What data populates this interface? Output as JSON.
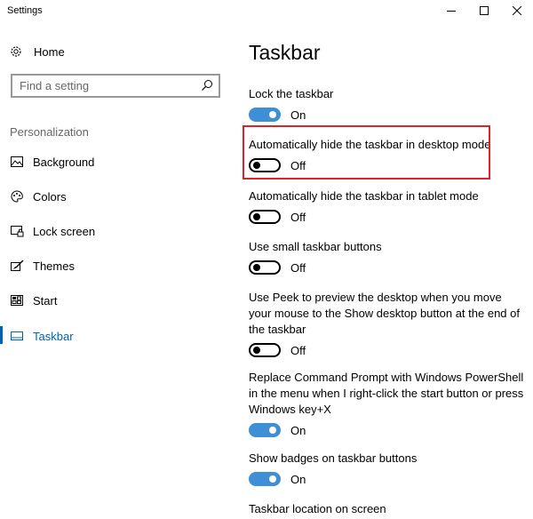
{
  "window": {
    "title": "Settings",
    "controls": {
      "minimize": "minimize-icon",
      "maximize": "maximize-icon",
      "close": "close-icon"
    }
  },
  "sidebar": {
    "home_label": "Home",
    "search_placeholder": "Find a setting",
    "section_title": "Personalization",
    "items": [
      {
        "label": "Background",
        "icon": "picture-icon"
      },
      {
        "label": "Colors",
        "icon": "palette-icon"
      },
      {
        "label": "Lock screen",
        "icon": "lock-screen-icon"
      },
      {
        "label": "Themes",
        "icon": "brush-icon"
      },
      {
        "label": "Start",
        "icon": "start-menu-icon"
      },
      {
        "label": "Taskbar",
        "icon": "taskbar-icon",
        "active": true
      }
    ]
  },
  "main": {
    "title": "Taskbar",
    "settings": [
      {
        "label": "Lock the taskbar",
        "state": "On"
      },
      {
        "label": "Automatically hide the taskbar in desktop mode",
        "state": "Off"
      },
      {
        "label": "Automatically hide the taskbar in tablet mode",
        "state": "Off"
      },
      {
        "label": "Use small taskbar buttons",
        "state": "Off"
      },
      {
        "label": "Use Peek to preview the desktop when you move your mouse to the Show desktop button at the end of the taskbar",
        "state": "Off"
      },
      {
        "label": "Replace Command Prompt with Windows PowerShell in the menu when I right-click the start button or press Windows key+X",
        "state": "On"
      },
      {
        "label": "Show badges on taskbar buttons",
        "state": "On"
      }
    ],
    "trailing_label": "Taskbar location on screen"
  },
  "colors": {
    "accent": "#0063b1",
    "toggle_on": "#3f8fd6",
    "highlight": "#e0212a"
  }
}
